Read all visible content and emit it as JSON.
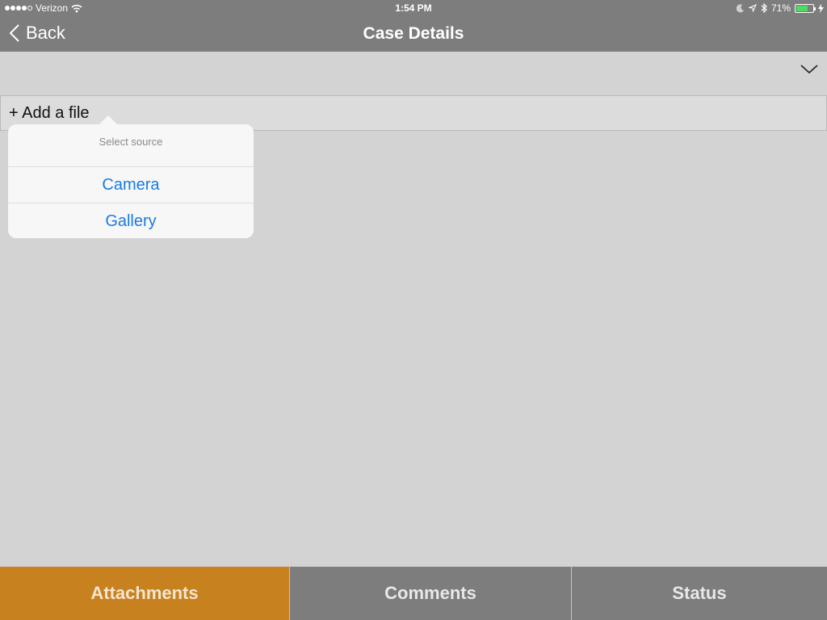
{
  "status_bar": {
    "carrier": "Verizon",
    "time": "1:54 PM",
    "battery": "71%",
    "battery_level": 0.71,
    "icons": [
      "signal-dots-icon",
      "wifi-icon",
      "moon-icon",
      "location-icon",
      "bluetooth-icon",
      "battery-icon",
      "charging-icon"
    ]
  },
  "navbar": {
    "back_label": "Back",
    "title": "Case Details"
  },
  "add_file": {
    "label": "+ Add a file"
  },
  "popover": {
    "title": "Select source",
    "items": [
      "Camera",
      "Gallery"
    ]
  },
  "tabs": [
    {
      "label": "Attachments",
      "active": true
    },
    {
      "label": "Comments",
      "active": false
    },
    {
      "label": "Status",
      "active": false
    }
  ],
  "colors": {
    "nav_background": "#7d7d7d",
    "content_background": "#d3d3d3",
    "accent_active_tab": "#c8811f",
    "link_blue": "#1a7be0",
    "battery_green": "#4cd964"
  }
}
